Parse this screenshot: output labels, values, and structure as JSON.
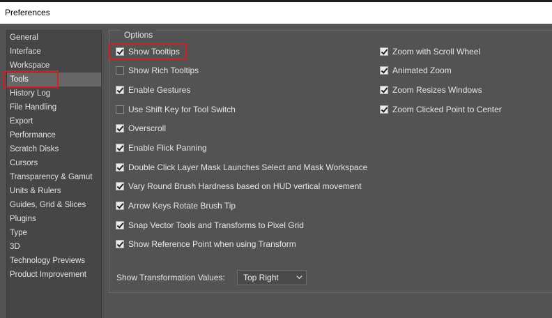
{
  "window": {
    "title": "Preferences"
  },
  "sidebar": {
    "items": [
      {
        "label": "General"
      },
      {
        "label": "Interface"
      },
      {
        "label": "Workspace"
      },
      {
        "label": "Tools"
      },
      {
        "label": "History Log"
      },
      {
        "label": "File Handling"
      },
      {
        "label": "Export"
      },
      {
        "label": "Performance"
      },
      {
        "label": "Scratch Disks"
      },
      {
        "label": "Cursors"
      },
      {
        "label": "Transparency & Gamut"
      },
      {
        "label": "Units & Rulers"
      },
      {
        "label": "Guides, Grid & Slices"
      },
      {
        "label": "Plugins"
      },
      {
        "label": "Type"
      },
      {
        "label": "3D"
      },
      {
        "label": "Technology Previews"
      },
      {
        "label": "Product Improvement"
      }
    ],
    "selected": "Tools"
  },
  "options": {
    "legend": "Options",
    "left": [
      {
        "label": "Show Tooltips",
        "checked": true
      },
      {
        "label": "Show Rich Tooltips",
        "checked": false
      },
      {
        "label": "Enable Gestures",
        "checked": true
      },
      {
        "label": "Use Shift Key for Tool Switch",
        "checked": false
      },
      {
        "label": "Overscroll",
        "checked": true
      },
      {
        "label": "Enable Flick Panning",
        "checked": true
      },
      {
        "label": "Double Click Layer Mask Launches Select and Mask Workspace",
        "checked": true
      },
      {
        "label": "Vary Round Brush Hardness based on HUD vertical movement",
        "checked": true
      },
      {
        "label": "Arrow Keys Rotate Brush Tip",
        "checked": true
      },
      {
        "label": "Snap Vector Tools and Transforms to Pixel Grid",
        "checked": true
      },
      {
        "label": "Show Reference Point when using Transform",
        "checked": true
      }
    ],
    "right": [
      {
        "label": "Zoom with Scroll Wheel",
        "checked": true
      },
      {
        "label": "Animated Zoom",
        "checked": true
      },
      {
        "label": "Zoom Resizes Windows",
        "checked": true
      },
      {
        "label": "Zoom Clicked Point to Center",
        "checked": true
      }
    ]
  },
  "transformation": {
    "label": "Show Transformation Values:",
    "value": "Top Right"
  },
  "colors": {
    "panel_bg": "#535353",
    "sidebar_bg": "#464646",
    "selected_bg": "#666666",
    "highlight": "#d61f1f"
  }
}
